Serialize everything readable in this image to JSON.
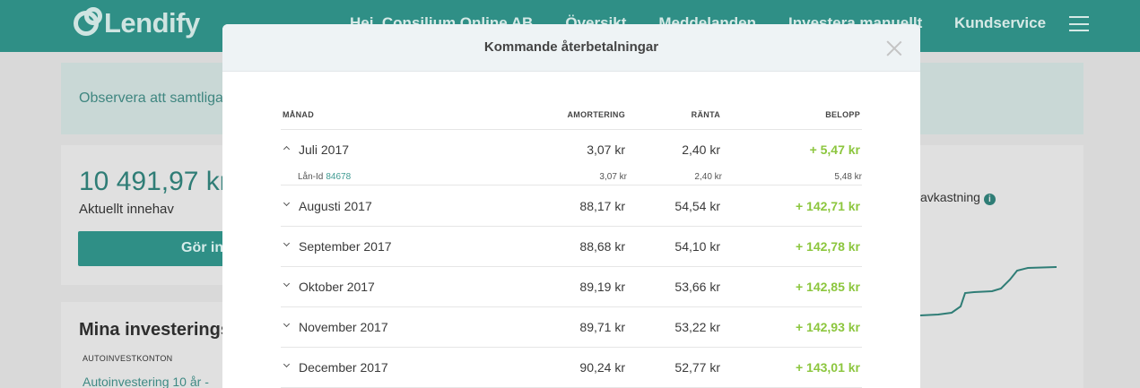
{
  "background": {
    "logo_text": "Lendify",
    "nav_items": [
      "Hej, Consilium Online AB",
      "Översikt",
      "Meddelanden",
      "Investera manuellt"
    ],
    "nav_kundservice": "Kundservice",
    "notice_text": "Observera att samtliga",
    "balance": "10 491,97 kr",
    "balance_label": "Aktuellt innehav",
    "invest_button": "Gör in",
    "mina_title": "Mina investeringsk",
    "autoinvest_label": "AUTOINVESTKONTON",
    "autoinvest_link": "Autoinvestering 10 år -",
    "avkastning_label": "avkastning",
    "brand_color": "#2f8f86"
  },
  "modal": {
    "title": "Kommande återbetalningar",
    "columns": {
      "month": "MÅNAD",
      "amortering": "AMORTERING",
      "ranta": "RÄNTA",
      "belopp": "BELOPP"
    },
    "rows": [
      {
        "month": "Juli 2017",
        "amortering": "3,07 kr",
        "ranta": "2,40 kr",
        "belopp": "+ 5,47 kr",
        "expanded": true
      },
      {
        "month": "Augusti 2017",
        "amortering": "88,17 kr",
        "ranta": "54,54 kr",
        "belopp": "+ 142,71 kr",
        "expanded": false
      },
      {
        "month": "September 2017",
        "amortering": "88,68 kr",
        "ranta": "54,10 kr",
        "belopp": "+ 142,78 kr",
        "expanded": false
      },
      {
        "month": "Oktober 2017",
        "amortering": "89,19 kr",
        "ranta": "53,66 kr",
        "belopp": "+ 142,85 kr",
        "expanded": false
      },
      {
        "month": "November 2017",
        "amortering": "89,71 kr",
        "ranta": "53,22 kr",
        "belopp": "+ 142,93 kr",
        "expanded": false
      },
      {
        "month": "December 2017",
        "amortering": "90,24 kr",
        "ranta": "52,77 kr",
        "belopp": "+ 143,01 kr",
        "expanded": false
      }
    ],
    "subrow": {
      "label": "Lån-Id",
      "loan_id": "84678",
      "amortering": "3,07 kr",
      "ranta": "2,40 kr",
      "belopp": "5,48 kr"
    },
    "positive_color": "#8cc63e"
  }
}
